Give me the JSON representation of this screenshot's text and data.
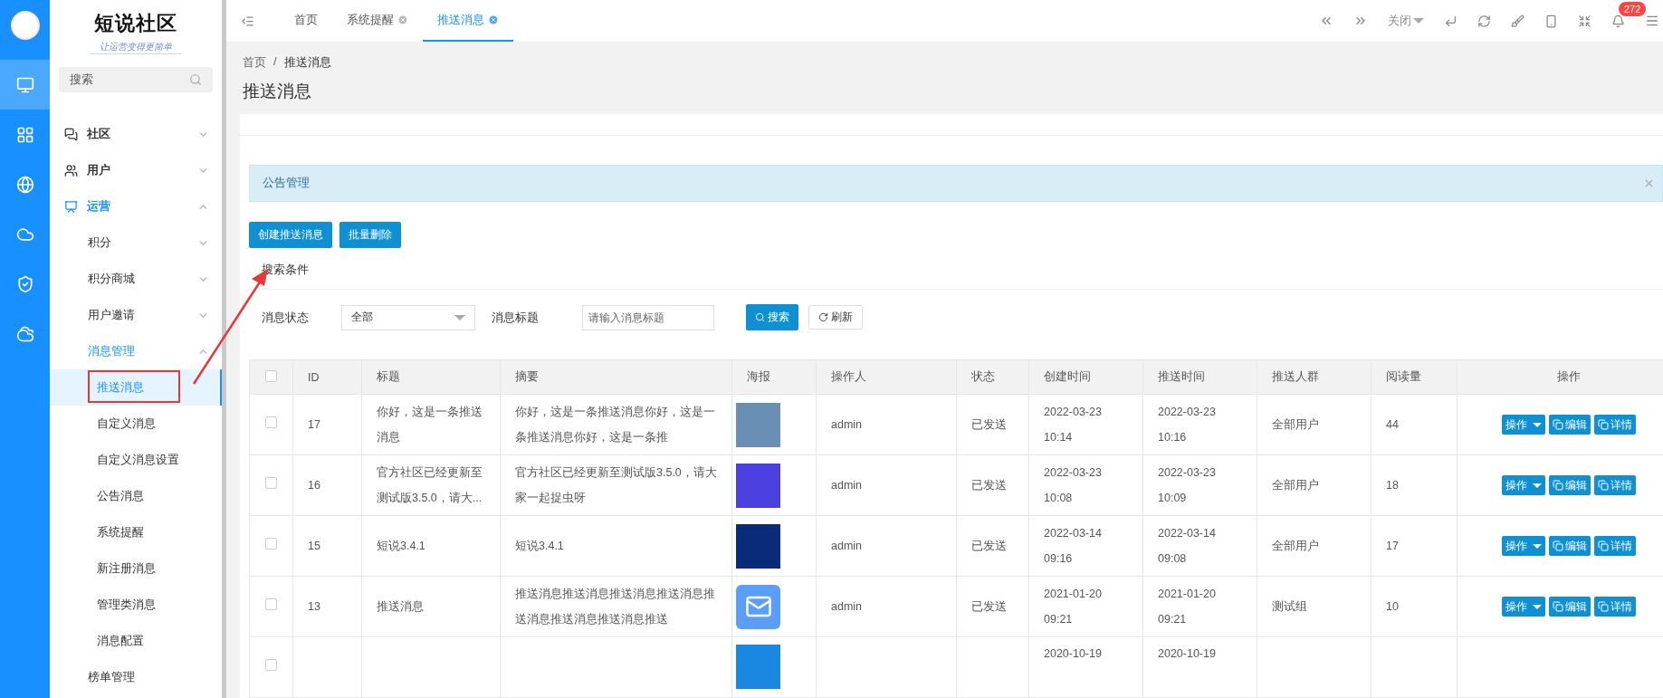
{
  "brand": {
    "title": "短说社区",
    "slogan": "让运营变得更简单"
  },
  "rail": [
    {
      "selected": true
    },
    {
      "selected": false
    },
    {
      "selected": false
    },
    {
      "selected": false
    },
    {
      "selected": false
    },
    {
      "selected": false
    }
  ],
  "sidebar": {
    "search": {
      "placeholder": "搜索"
    },
    "items": [
      {
        "label": "社区",
        "expanded": false,
        "selected": false
      },
      {
        "label": "用户",
        "expanded": false,
        "selected": false
      },
      {
        "label": "运营",
        "expanded": true,
        "selected": true,
        "children": [
          {
            "label": "积分",
            "expanded": false,
            "selected": false
          },
          {
            "label": "积分商城",
            "expanded": false,
            "selected": false
          },
          {
            "label": "用户邀请",
            "expanded": false,
            "selected": false
          },
          {
            "label": "消息管理",
            "expanded": true,
            "selected": true,
            "children": [
              {
                "label": "推送消息",
                "selected": true
              },
              {
                "label": "自定义消息",
                "selected": false
              },
              {
                "label": "自定义消息设置",
                "selected": false
              },
              {
                "label": "公告消息",
                "selected": false
              },
              {
                "label": "系统提醒",
                "selected": false
              },
              {
                "label": "新注册消息",
                "selected": false
              },
              {
                "label": "管理类消息",
                "selected": false
              },
              {
                "label": "消息配置",
                "selected": false
              }
            ]
          },
          {
            "label": "榜单管理",
            "selected": false
          }
        ]
      }
    ]
  },
  "tabs": [
    {
      "label": "首页",
      "closable": false,
      "selected": false
    },
    {
      "label": "系统提醒",
      "closable": true,
      "selected": false
    },
    {
      "label": "推送消息",
      "closable": true,
      "selected": true
    }
  ],
  "toolbar": {
    "close_menu": "关闭",
    "notification_count": "272"
  },
  "breadcrumb": {
    "separator": "/",
    "items": [
      "首页",
      "推送消息"
    ]
  },
  "page_title": "推送消息",
  "alert": {
    "text": "公告管理"
  },
  "actions": [
    "创建推送消息",
    "批量删除"
  ],
  "search_section": {
    "title": "搜索条件",
    "status_label": "消息状态",
    "status_value": "全部",
    "title_label": "消息标题",
    "title_placeholder": "请输入消息标题",
    "search_button": "搜索",
    "refresh_button": "刷新"
  },
  "table": {
    "select_all_checked": false,
    "columns": [
      "ID",
      "标题",
      "摘要",
      "海报",
      "操作人",
      "状态",
      "创建时间",
      "推送时间",
      "推送人群",
      "阅读量",
      "操作"
    ],
    "rows": [
      {
        "checked": false,
        "id": "17",
        "title": "你好，这是一条推送消息",
        "summary": "你好，这是一条推送消息你好，这是一条推送消息你好，这是一条推",
        "kind": "photo",
        "operator": "admin",
        "status": "已发送",
        "created": [
          "2022-03-23",
          "10:14"
        ],
        "pushed": [
          "2022-03-23",
          "10:16"
        ],
        "audience": "全部用户",
        "reads": "44",
        "actions": [
          {
            "label": "操作",
            "kind": "dropdown"
          },
          {
            "label": "编辑",
            "kind": "copy"
          },
          {
            "label": "详情",
            "kind": "copy"
          }
        ]
      },
      {
        "checked": false,
        "id": "16",
        "title": "官方社区已经更新至测试版3.5.0，请大...",
        "summary": "官方社区已经更新至测试版3.5.0，请大家一起捉虫呀",
        "kind": "photo",
        "operator": "admin",
        "status": "已发送",
        "created": [
          "2022-03-23",
          "10:08"
        ],
        "pushed": [
          "2022-03-23",
          "10:09"
        ],
        "audience": "全部用户",
        "reads": "18",
        "actions": [
          {
            "label": "操作",
            "kind": "dropdown"
          },
          {
            "label": "编辑",
            "kind": "copy"
          },
          {
            "label": "详情",
            "kind": "copy"
          }
        ]
      },
      {
        "checked": false,
        "id": "15",
        "title": "短说3.4.1",
        "summary": "短说3.4.1",
        "kind": "photo",
        "operator": "admin",
        "status": "已发送",
        "created": [
          "2022-03-14",
          "09:16"
        ],
        "pushed": [
          "2022-03-14",
          "09:08"
        ],
        "audience": "全部用户",
        "reads": "17",
        "actions": [
          {
            "label": "操作",
            "kind": "dropdown"
          },
          {
            "label": "编辑",
            "kind": "copy"
          },
          {
            "label": "详情",
            "kind": "copy"
          }
        ]
      },
      {
        "checked": false,
        "id": "13",
        "title": "推送消息",
        "summary": "推送消息推送消息推送消息推送消息推送消息推送消息推送消息推送",
        "kind": "mail",
        "operator": "admin",
        "status": "已发送",
        "created": [
          "2021-01-20",
          "09:21"
        ],
        "pushed": [
          "2021-01-20",
          "09:21"
        ],
        "audience": "测试组",
        "reads": "10",
        "actions": [
          {
            "label": "操作",
            "kind": "dropdown"
          },
          {
            "label": "编辑",
            "kind": "copy"
          },
          {
            "label": "详情",
            "kind": "copy"
          }
        ]
      },
      {
        "checked": false,
        "kind": "photo",
        "created": [
          "2020-10-19"
        ],
        "pushed": [
          "2020-10-19"
        ],
        "actions": []
      }
    ]
  }
}
